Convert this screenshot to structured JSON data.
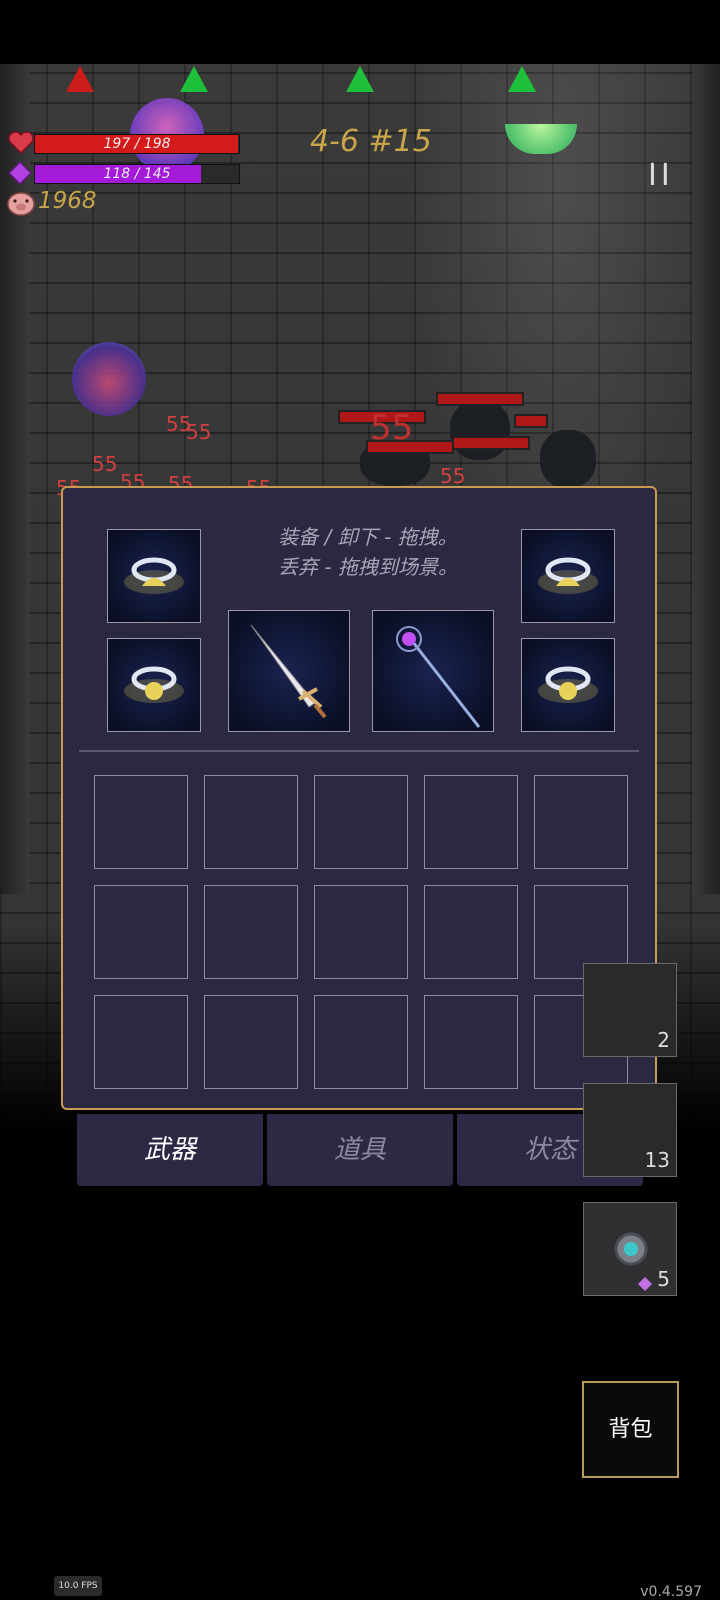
{
  "hud": {
    "hp_text": "197 / 198",
    "hp_fraction": 0.995,
    "mp_text": "118 / 145",
    "mp_fraction": 0.814,
    "gold": "1968",
    "stage": "4-6 #15",
    "pause_symbol": "II",
    "icons": {
      "hp": "heart-icon",
      "mp": "diamond-icon",
      "gold": "pig-icon"
    },
    "colors": {
      "hp": "#d41a1a",
      "mp": "#a31ad8",
      "gold_text": "#c9a64a"
    }
  },
  "scene": {
    "damage_numbers": [
      "55",
      "55",
      "55",
      "55",
      "55",
      "55",
      "55",
      "55",
      "55"
    ]
  },
  "inventory": {
    "hint_line1": "装备 / 卸下 - 拖拽。",
    "hint_line2": "丢弃 - 拖拽到场景。",
    "equipped": [
      {
        "slot": "ring-top-left",
        "item": "ring"
      },
      {
        "slot": "ring-bottom-left",
        "item": "ring"
      },
      {
        "slot": "weapon-main",
        "item": "greatsword"
      },
      {
        "slot": "weapon-off",
        "item": "staff"
      },
      {
        "slot": "ring-top-right",
        "item": "ring"
      },
      {
        "slot": "ring-bottom-right",
        "item": "ring"
      }
    ],
    "grid_rows": 3,
    "grid_cols": 5,
    "tabs": [
      {
        "label": "武器",
        "active": true
      },
      {
        "label": "道具",
        "active": false
      },
      {
        "label": "状态",
        "active": false
      }
    ]
  },
  "quickslots": [
    {
      "count": "2"
    },
    {
      "count": "13"
    },
    {
      "count": "5",
      "icon": "gem-icon"
    }
  ],
  "bag_label": "背包",
  "fps": "10.0 FPS",
  "version": "v0.4.597"
}
